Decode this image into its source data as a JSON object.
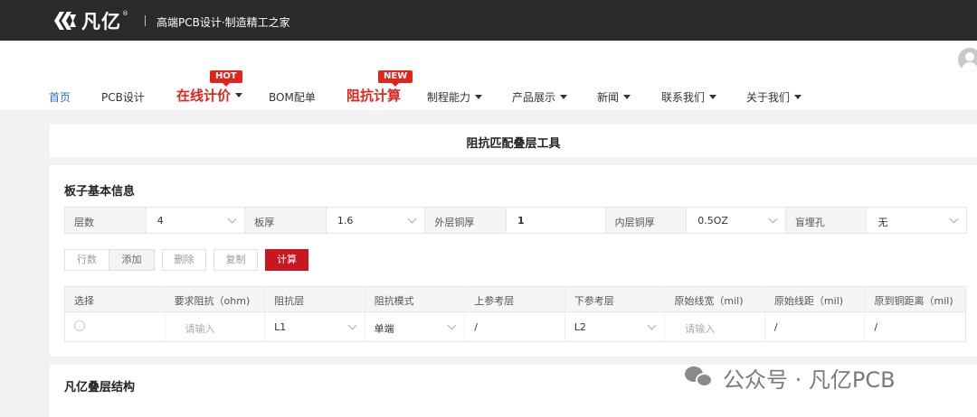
{
  "header": {
    "brand": "凡亿",
    "slogan": "高端PCB设计·制造精工之家"
  },
  "nav": {
    "items": [
      {
        "label": "首页"
      },
      {
        "label": "PCB设计"
      },
      {
        "label": "在线计价",
        "badge": "HOT"
      },
      {
        "label": "BOM配单"
      },
      {
        "label": "阻抗计算",
        "badge": "NEW"
      },
      {
        "label": "制程能力"
      },
      {
        "label": "产品展示"
      },
      {
        "label": "新闻"
      },
      {
        "label": "联系我们"
      },
      {
        "label": "关于我们"
      }
    ]
  },
  "page_title": "阻抗匹配叠层工具",
  "basic_info": {
    "title": "板子基本信息",
    "fields": [
      {
        "label": "层数",
        "value": "4"
      },
      {
        "label": "板厚",
        "value": "1.6"
      },
      {
        "label": "外层铜厚",
        "value": "1"
      },
      {
        "label": "内层铜厚",
        "value": "0.5OZ"
      },
      {
        "label": "盲埋孔",
        "value": "无"
      }
    ]
  },
  "buttons": {
    "rows": "行数",
    "add": "添加",
    "delete": "删除",
    "copy": "复制",
    "calculate": "计算"
  },
  "table": {
    "headers": [
      "选择",
      "要求阻抗（ohm)",
      "阻抗层",
      "阻抗模式",
      "上参考层",
      "下参考层",
      "原始线宽（mil)",
      "原始线距（mil)",
      "原到铜距离（mil)"
    ],
    "row": {
      "impedance_placeholder": "请输入",
      "layer": "L1",
      "mode": "单端",
      "top_ref": "/",
      "bottom_ref": "L2",
      "width_placeholder": "请输入",
      "spacing": "/",
      "copper_distance": "/"
    }
  },
  "stackup": {
    "title": "凡亿叠层结构"
  },
  "watermark": "公众号 · 凡亿PCB",
  "colors": {
    "topbar": "#2a2a2a",
    "accent_red": "#e1251b",
    "calc_button": "#c8171e",
    "active_link": "#2d6bd1"
  }
}
